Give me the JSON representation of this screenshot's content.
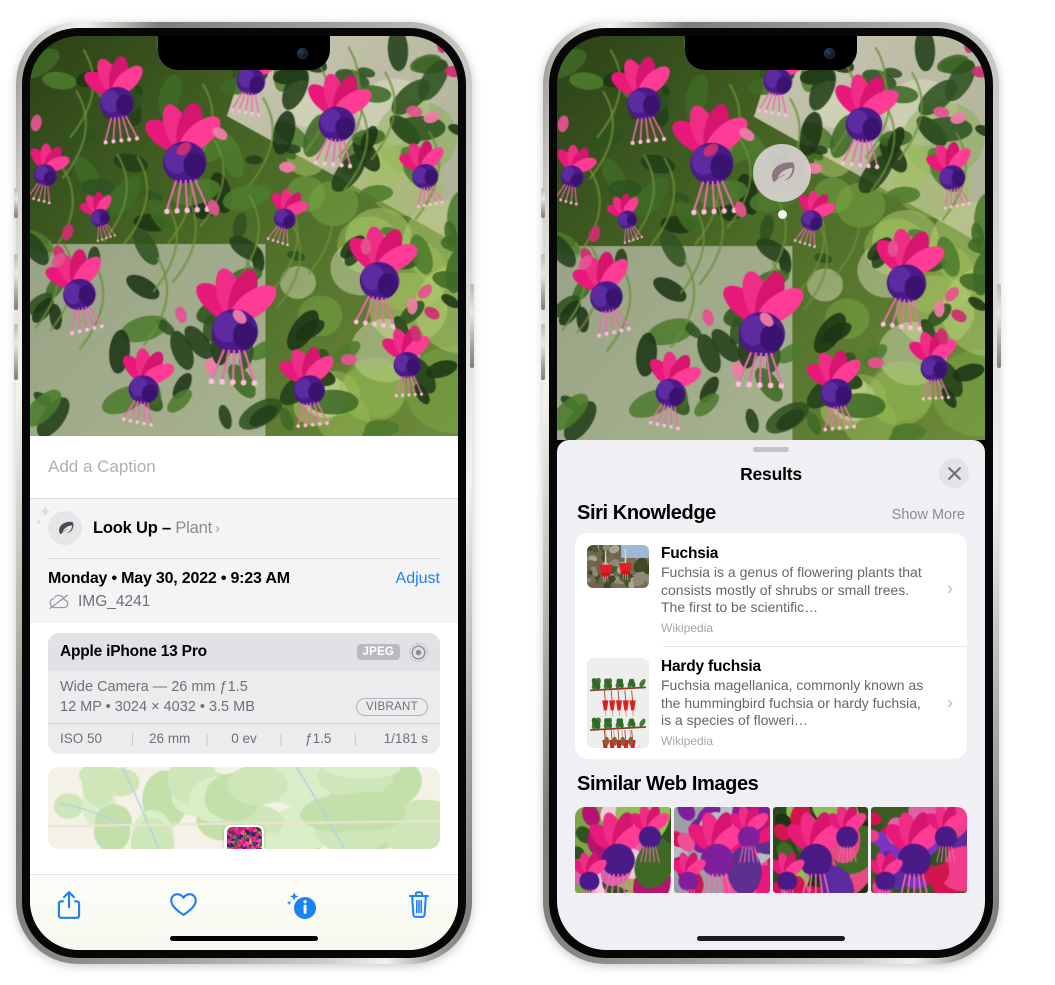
{
  "left_phone": {
    "caption": {
      "placeholder": "Add a Caption",
      "value": ""
    },
    "lookup": {
      "label": "Look Up",
      "dash": " – ",
      "subject": "Plant",
      "icon": "leaf-icon",
      "chevron": "›"
    },
    "meta": {
      "date": "Monday • May 30, 2022 • 9:23 AM",
      "adjust_label": "Adjust",
      "filename": "IMG_4241",
      "cloud_icon": "cloud-slash-icon"
    },
    "camera_card": {
      "device": "Apple iPhone 13 Pro",
      "format_badge": "JPEG",
      "aperture_icon": "aperture-icon",
      "lens_line": "Wide Camera — 26 mm ƒ1.5",
      "specs_line": "12 MP • 3024 × 4032 • 3.5 MB",
      "style_badge": "VIBRANT",
      "exif": [
        "ISO 50",
        "26 mm",
        "0 ev",
        "ƒ1.5",
        "1/181 s"
      ]
    },
    "toolbar": {
      "share_label": "share-icon",
      "favorite_label": "heart-icon",
      "info_label": "info-sparkle-icon",
      "delete_label": "trash-icon",
      "accent_color": "#1b82f6"
    }
  },
  "right_phone": {
    "visual_lookup_badge": {
      "icon": "leaf-icon"
    },
    "sheet": {
      "title": "Results",
      "close_icon": "close-icon",
      "sections": [
        {
          "title": "Siri Knowledge",
          "action": "Show More",
          "items": [
            {
              "title": "Fuchsia",
              "description": "Fuchsia is a genus of flowering plants that consists mostly of shrubs or small trees. The first to be scientific…",
              "source": "Wikipedia",
              "chevron": "›"
            },
            {
              "title": "Hardy fuchsia",
              "description": "Fuchsia magellanica, commonly known as the hummingbird fuchsia or hardy fuchsia, is a species of floweri…",
              "source": "Wikipedia",
              "chevron": "›"
            }
          ]
        },
        {
          "title": "Similar Web Images",
          "action": "",
          "image_count": 4
        }
      ]
    }
  },
  "colors": {
    "accent": "#1b82f6",
    "sheet_bg": "#f0f0f4",
    "card_bg": "#ffffff",
    "secondary_text": "#6f6f75"
  }
}
